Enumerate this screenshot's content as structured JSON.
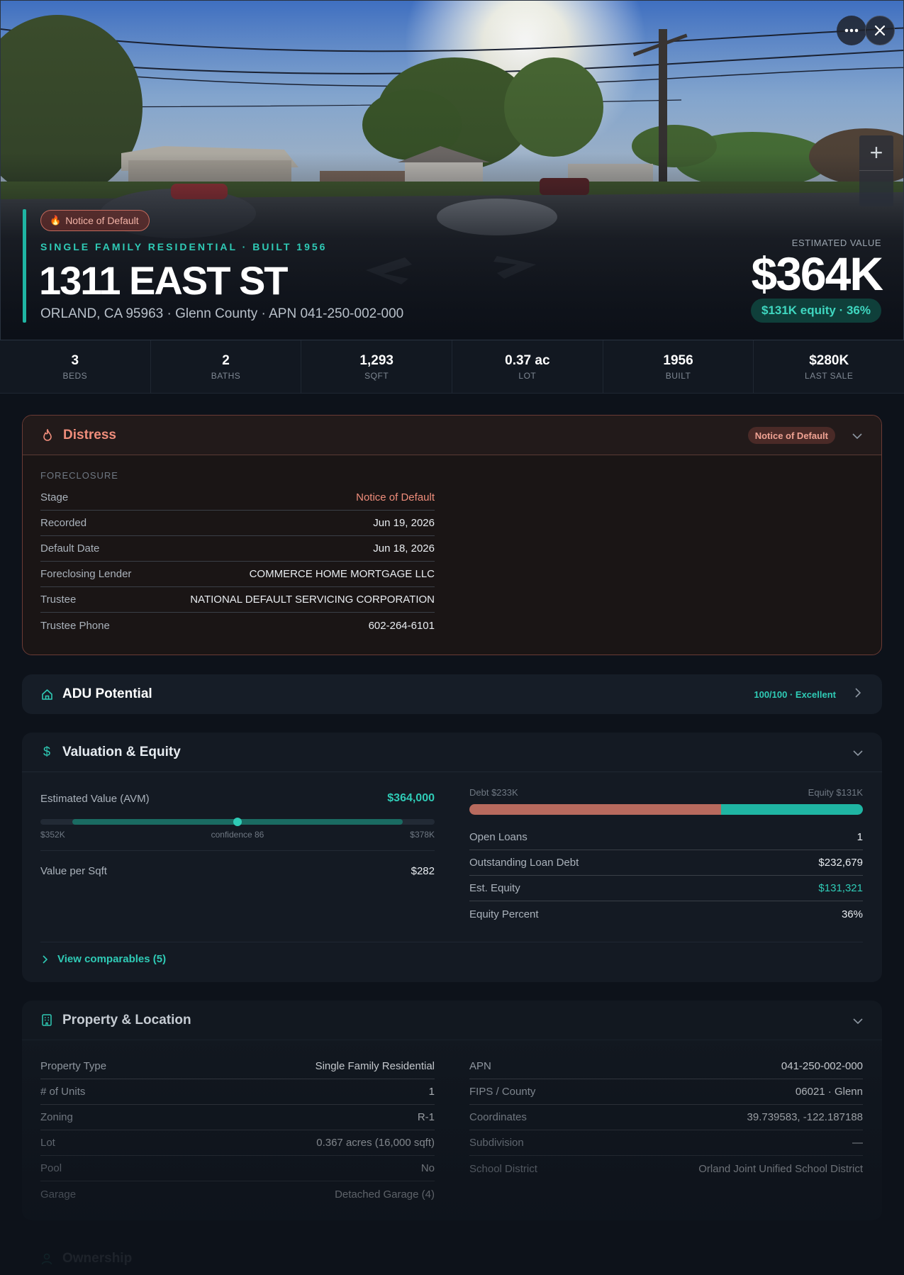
{
  "hero": {
    "badge": "Notice of Default",
    "subtitle": "SINGLE FAMILY RESIDENTIAL · BUILT 1956",
    "title": "1311 EAST ST",
    "address": "ORLAND, CA 95963 · Glenn County · APN 041-250-002-000",
    "estimated_label": "ESTIMATED VALUE",
    "estimated_value": "$364K",
    "equity_pill": "$131K equity · 36%",
    "more_icon": "ellipsis-icon",
    "close_icon": "close-icon",
    "zoom_in_label": "+"
  },
  "stats": [
    {
      "value": "3",
      "label": "BEDS"
    },
    {
      "value": "2",
      "label": "BATHS"
    },
    {
      "value": "1,293",
      "label": "SQFT"
    },
    {
      "value": "0.37 ac",
      "label": "LOT"
    },
    {
      "value": "1956",
      "label": "BUILT"
    },
    {
      "value": "$280K",
      "label": "LAST SALE"
    }
  ],
  "distress": {
    "title": "Distress",
    "badge": "Notice of Default",
    "section": "FORECLOSURE",
    "rows": [
      {
        "k": "Stage",
        "v": "Notice of Default"
      },
      {
        "k": "Recorded",
        "v": "Jun 19, 2026"
      },
      {
        "k": "Default Date",
        "v": "Jun 18, 2026"
      },
      {
        "k": "Foreclosing Lender",
        "v": "COMMERCE HOME MORTGAGE LLC"
      },
      {
        "k": "Trustee",
        "v": "NATIONAL DEFAULT SERVICING CORPORATION"
      },
      {
        "k": "Trustee Phone",
        "v": "602-264-6101"
      }
    ]
  },
  "adu": {
    "title": "ADU Potential",
    "score": "100/100 · Excellent"
  },
  "valuation": {
    "title": "Valuation & Equity",
    "avm_label": "Estimated Value (AVM)",
    "avm_value": "$364,000",
    "range_low": "$352K",
    "range_mid": "confidence 86",
    "range_high": "$378K",
    "value_per_sqft_label": "Value per Sqft",
    "value_per_sqft": "$282",
    "debt_label": "Debt $233K",
    "equity_label": "Equity $131K",
    "debt_fraction": 0.64,
    "rows": [
      {
        "k": "Open Loans",
        "v": "1"
      },
      {
        "k": "Outstanding Loan Debt",
        "v": "$232,679"
      },
      {
        "k": "Est. Equity",
        "v": "$131,321"
      },
      {
        "k": "Equity Percent",
        "v": "36%"
      }
    ],
    "comps_link": "View comparables (5)"
  },
  "property": {
    "title": "Property & Location",
    "left": [
      {
        "k": "Property Type",
        "v": "Single Family Residential"
      },
      {
        "k": "# of Units",
        "v": "1"
      },
      {
        "k": "Zoning",
        "v": "R-1"
      },
      {
        "k": "Lot",
        "v": "0.367 acres (16,000 sqft)"
      },
      {
        "k": "Pool",
        "v": "No"
      },
      {
        "k": "Garage",
        "v": "Detached Garage (4)"
      }
    ],
    "right": [
      {
        "k": "APN",
        "v": "041-250-002-000"
      },
      {
        "k": "FIPS / County",
        "v": "06021 · Glenn"
      },
      {
        "k": "Coordinates",
        "v": "39.739583, -122.187188"
      },
      {
        "k": "Subdivision",
        "v": "—"
      },
      {
        "k": "School District",
        "v": "Orland Joint Unified School District"
      }
    ]
  },
  "ownership": {
    "title": "Ownership"
  },
  "colors": {
    "accent": "#1fb5a3",
    "distress": "#ef8d7b",
    "debt": "#b86a5e",
    "equity": "#1fb5a3"
  }
}
